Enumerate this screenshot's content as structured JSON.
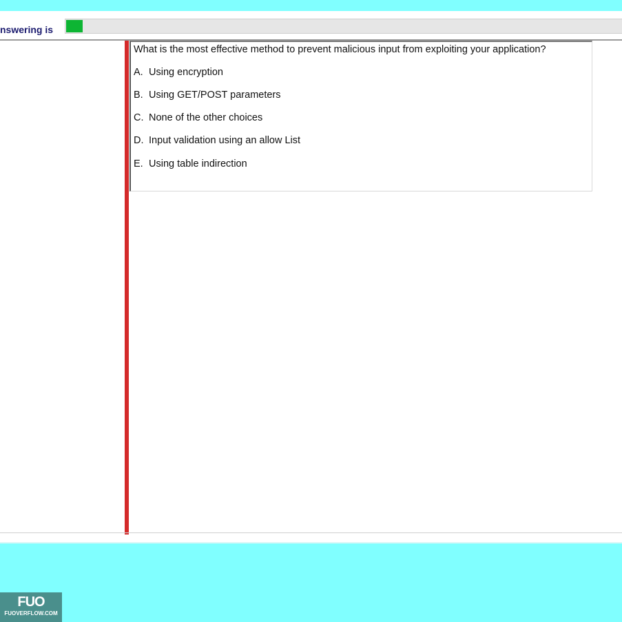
{
  "status": {
    "label": "nswering is",
    "progress_percent": 3
  },
  "question": {
    "text": "What is the most effective method to prevent malicious input from exploiting your application?",
    "options": [
      {
        "letter": "A.",
        "text": "Using encryption"
      },
      {
        "letter": "B.",
        "text": "Using GET/POST parameters"
      },
      {
        "letter": "C.",
        "text": "None of the other choices"
      },
      {
        "letter": "D.",
        "text": "Input validation using an allow List"
      },
      {
        "letter": "E.",
        "text": "Using table indirection"
      }
    ]
  },
  "watermark": {
    "logo": "FUO",
    "site": "FUOVERFLOW.COM"
  },
  "colors": {
    "band": "#80ffff",
    "progress_fill": "#0db533",
    "divider": "#d42a2a"
  }
}
